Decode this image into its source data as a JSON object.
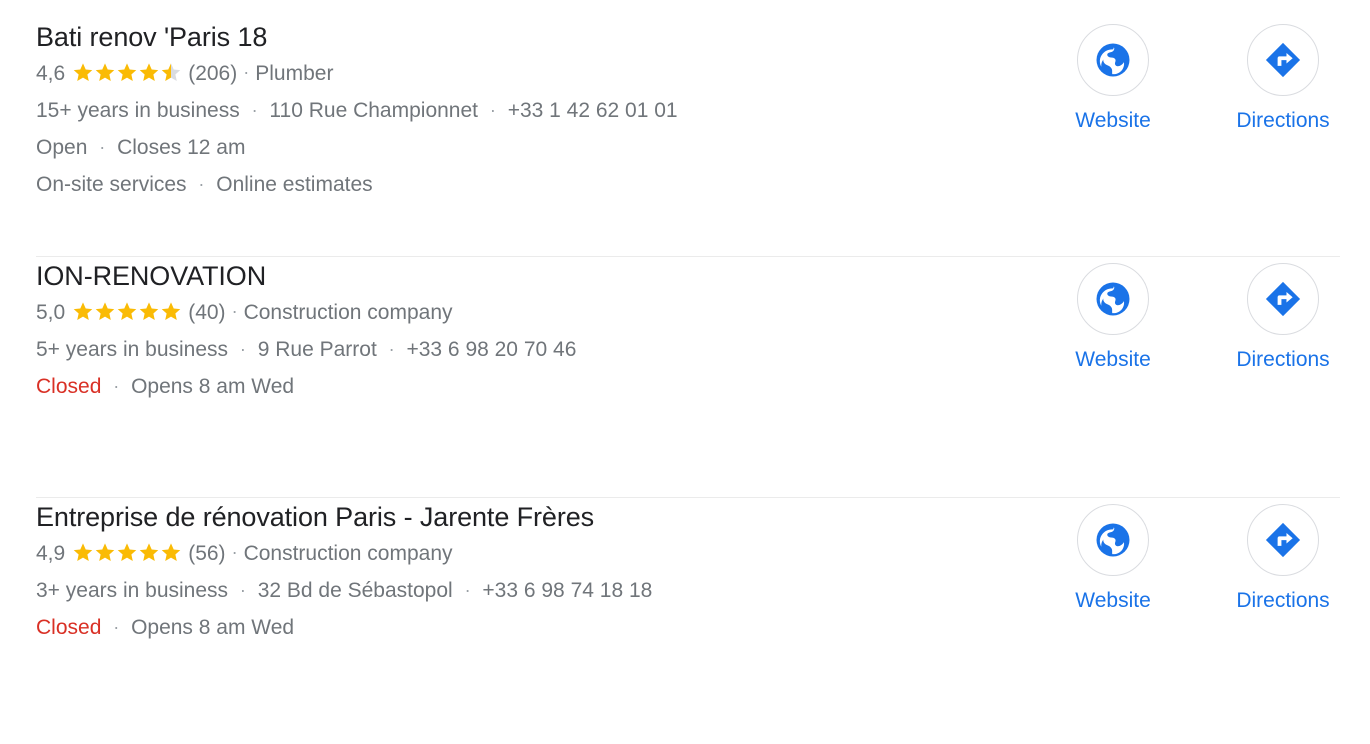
{
  "colors": {
    "title": "#202124",
    "secondary_text": "#70757a",
    "link": "#1a73e8",
    "star_gold": "#fabb05",
    "star_empty": "#dadce0",
    "closed_red": "#d93025",
    "divider": "#ebebeb",
    "icon_blue": "#1a73e8",
    "circle_border": "#dadce0"
  },
  "separator": "·",
  "results": [
    {
      "title": "Bati renov 'Paris 18",
      "rating": "4,6",
      "stars_full": 4,
      "stars_half": 1,
      "stars_empty": 0,
      "review_count": "(206)",
      "category": "Plumber",
      "years_in_business": "15+ years in business",
      "address": "110 Rue Championnet",
      "phone": "+33 1 42 62 01 01",
      "status": "Open",
      "status_type": "open",
      "hours": "Closes 12 am",
      "attributes": [
        "On-site services",
        "Online estimates"
      ],
      "actions": [
        {
          "label": "Website",
          "icon": "globe-icon"
        },
        {
          "label": "Directions",
          "icon": "directions-icon"
        }
      ]
    },
    {
      "title": "ION-RENOVATION",
      "rating": "5,0",
      "stars_full": 5,
      "stars_half": 0,
      "stars_empty": 0,
      "review_count": "(40)",
      "category": "Construction company",
      "years_in_business": "5+ years in business",
      "address": "9 Rue Parrot",
      "phone": "+33 6 98 20 70 46",
      "status": "Closed",
      "status_type": "closed",
      "hours": "Opens 8 am Wed",
      "attributes": [],
      "actions": [
        {
          "label": "Website",
          "icon": "globe-icon"
        },
        {
          "label": "Directions",
          "icon": "directions-icon"
        }
      ]
    },
    {
      "title": "Entreprise de rénovation Paris - Jarente Frères",
      "rating": "4,9",
      "stars_full": 5,
      "stars_half": 0,
      "stars_empty": 0,
      "review_count": "(56)",
      "category": "Construction company",
      "years_in_business": "3+ years in business",
      "address": "32 Bd de Sébastopol",
      "phone": "+33 6 98 74 18 18",
      "status": "Closed",
      "status_type": "closed",
      "hours": "Opens 8 am Wed",
      "attributes": [],
      "actions": [
        {
          "label": "Website",
          "icon": "globe-icon"
        },
        {
          "label": "Directions",
          "icon": "directions-icon"
        }
      ]
    }
  ]
}
